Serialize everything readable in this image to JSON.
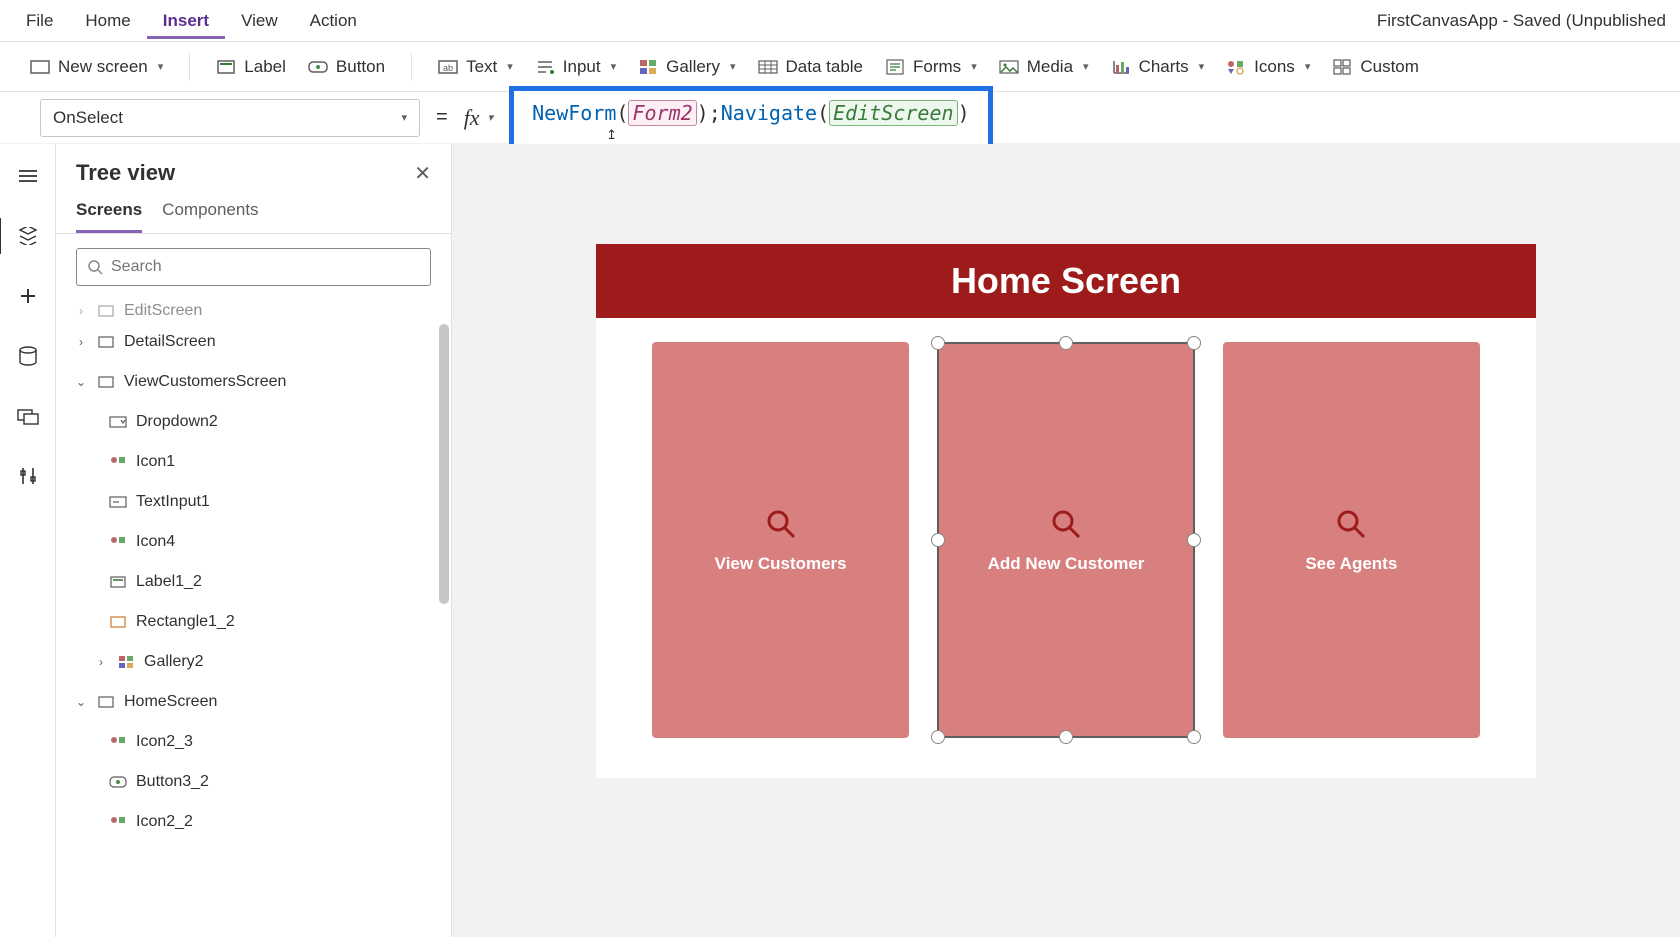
{
  "menu": {
    "file": "File",
    "home": "Home",
    "insert": "Insert",
    "view": "View",
    "action": "Action"
  },
  "app_status": "FirstCanvasApp - Saved (Unpublished",
  "ribbon": {
    "new_screen": "New screen",
    "label": "Label",
    "button": "Button",
    "text": "Text",
    "input": "Input",
    "gallery": "Gallery",
    "data_table": "Data table",
    "forms": "Forms",
    "media": "Media",
    "charts": "Charts",
    "icons": "Icons",
    "custom": "Custom"
  },
  "formula": {
    "property": "OnSelect",
    "fx": "fx",
    "fn1": "NewForm",
    "arg1": "Form2",
    "fn2": "Navigate",
    "arg2": "EditScreen"
  },
  "tree": {
    "title": "Tree view",
    "tab_screens": "Screens",
    "tab_components": "Components",
    "search_placeholder": "Search",
    "items": {
      "editscreen_cut": "EditScreen",
      "detail": "DetailScreen",
      "viewcust": "ViewCustomersScreen",
      "dropdown2": "Dropdown2",
      "icon1": "Icon1",
      "textinput1": "TextInput1",
      "icon4": "Icon4",
      "label1_2": "Label1_2",
      "rect1_2": "Rectangle1_2",
      "gallery2": "Gallery2",
      "homescreen": "HomeScreen",
      "icon2_3": "Icon2_3",
      "button3_2": "Button3_2",
      "icon2_2": "Icon2_2"
    }
  },
  "canvas": {
    "title": "Home Screen",
    "cards": [
      {
        "label": "View Customers"
      },
      {
        "label": "Add New Customer"
      },
      {
        "label": "See Agents"
      }
    ]
  }
}
